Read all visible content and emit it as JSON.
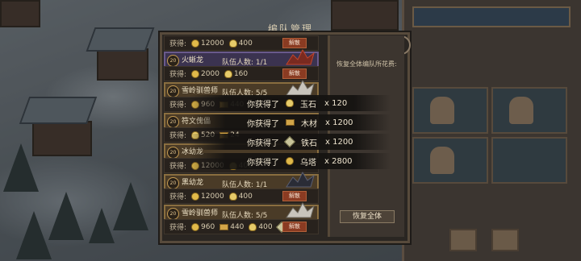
{
  "modal": {
    "title": "编队管理",
    "close_symbol": "✕"
  },
  "colors": {
    "accent_gold": "#e0b94a",
    "dismiss_red": "#8a3b22",
    "purple_frame": "#6a5a8c"
  },
  "list": {
    "reward_label": "获得:",
    "dismiss_label": "解散",
    "rows": [
      {
        "kind": "reward",
        "items": [
          {
            "icon": "gold-coin-icon",
            "amount": "12000"
          },
          {
            "icon": "food-icon",
            "amount": "400"
          }
        ],
        "dismiss": true
      },
      {
        "kind": "team",
        "level": "20",
        "name": "火蜥龙",
        "count": "队伍人数: 1/1",
        "frame": "purple",
        "hero": "red-dragon-icon"
      },
      {
        "kind": "reward",
        "items": [
          {
            "icon": "gold-coin-icon",
            "amount": "2000"
          },
          {
            "icon": "food-icon",
            "amount": "160"
          }
        ],
        "dismiss": true
      },
      {
        "kind": "team",
        "level": "20",
        "name": "雪岭驯兽师",
        "count": "队伍人数: 5/5",
        "frame": "gold",
        "hero": "beast-tamer-icon"
      },
      {
        "kind": "reward",
        "items": [
          {
            "icon": "gold-coin-icon",
            "amount": "960"
          },
          {
            "icon": "wood-icon",
            "amount": "440"
          }
        ],
        "dismiss": false
      },
      {
        "kind": "team",
        "level": "20",
        "name": "符文傀儡",
        "count": "",
        "frame": "gold",
        "hero": ""
      },
      {
        "kind": "reward",
        "items": [
          {
            "icon": "food-icon",
            "amount": "520"
          },
          {
            "icon": "wood-icon",
            "amount": "24"
          }
        ],
        "dismiss": false
      },
      {
        "kind": "team",
        "level": "20",
        "name": "冰幼龙",
        "count": "",
        "frame": "gold",
        "hero": ""
      },
      {
        "kind": "reward",
        "items": [
          {
            "icon": "gold-coin-icon",
            "amount": "12000"
          },
          {
            "icon": "food-icon",
            "amount": "400"
          }
        ],
        "dismiss": false
      },
      {
        "kind": "team",
        "level": "20",
        "name": "黑幼龙",
        "count": "队伍人数: 1/1",
        "frame": "gold",
        "hero": "black-dragon-icon"
      },
      {
        "kind": "reward",
        "items": [
          {
            "icon": "gold-coin-icon",
            "amount": "12000"
          },
          {
            "icon": "food-icon",
            "amount": "400"
          }
        ],
        "dismiss": true
      },
      {
        "kind": "team",
        "level": "20",
        "name": "雪岭驯兽师",
        "count": "队伍人数: 5/5",
        "frame": "gold",
        "hero": "beast-tamer-icon"
      },
      {
        "kind": "reward",
        "items": [
          {
            "icon": "gold-coin-icon",
            "amount": "960"
          },
          {
            "icon": "wood-icon",
            "amount": "440"
          },
          {
            "icon": "food-icon",
            "amount": "400"
          },
          {
            "icon": "ore-icon",
            "amount": "40"
          }
        ],
        "dismiss": true
      }
    ]
  },
  "restore": {
    "cost_label": "恢复全体编队所花费:",
    "button_label": "恢复全体"
  },
  "toasts": [
    {
      "prefix": "你获得了",
      "icon": "food-icon",
      "resource": "玉石",
      "qty": "x 120"
    },
    {
      "prefix": "你获得了",
      "icon": "wood-icon",
      "resource": "木材",
      "qty": "x 1200"
    },
    {
      "prefix": "你获得了",
      "icon": "ore-icon",
      "resource": "铁石",
      "qty": "x 1200"
    },
    {
      "prefix": "你获得了",
      "icon": "gold-coin-icon",
      "resource": "乌塔",
      "qty": "x 2800"
    }
  ]
}
